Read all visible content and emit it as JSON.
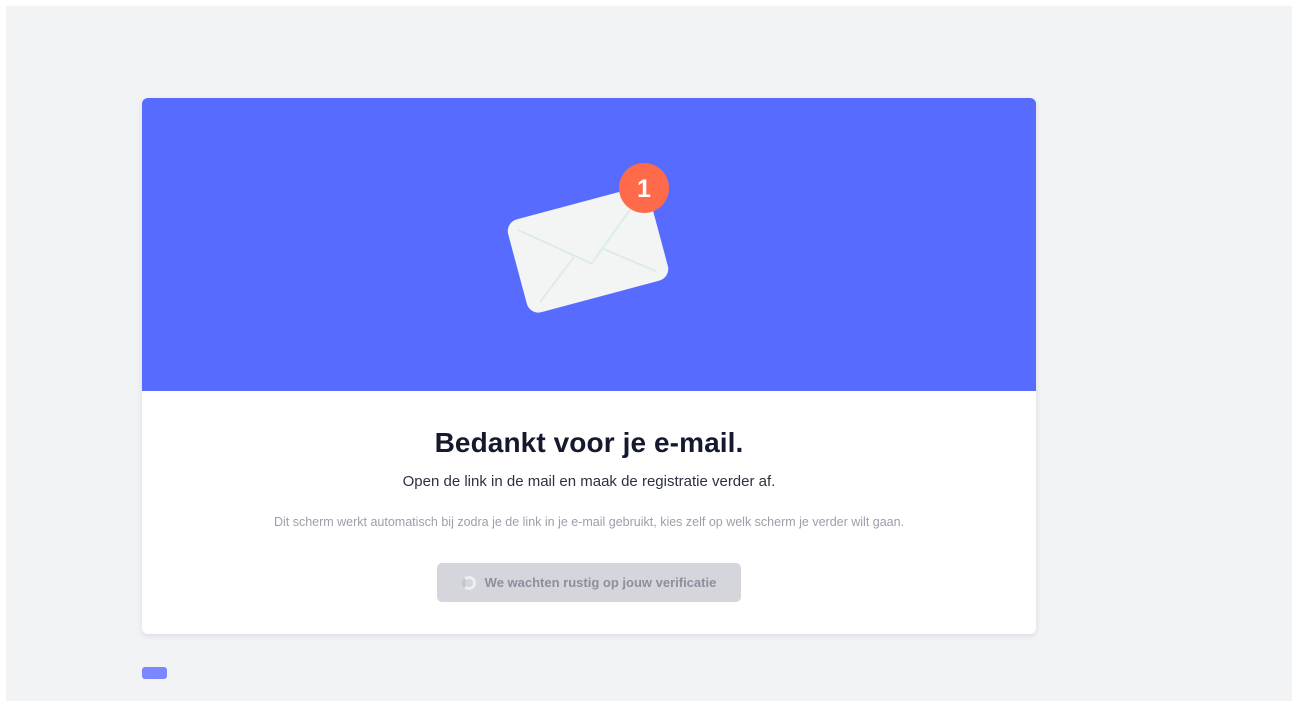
{
  "colors": {
    "hero_background": "#576cff",
    "page_background": "#f2f3f5",
    "badge": "#ff6b4a",
    "button_background": "#d4d6dc",
    "pill": "#7a87ff"
  },
  "hero": {
    "illustration": "envelope-icon",
    "badge_count": "1"
  },
  "content": {
    "title": "Bedankt voor je e-mail.",
    "subtitle": "Open de link in de mail en maak de registratie verder af.",
    "note": "Dit scherm werkt automatisch bij zodra je de link in je e-mail gebruikt, kies zelf op welk scherm je verder wilt gaan."
  },
  "wait_button": {
    "label": "We wachten rustig op jouw verificatie",
    "icon": "spinner-icon",
    "disabled": true
  }
}
